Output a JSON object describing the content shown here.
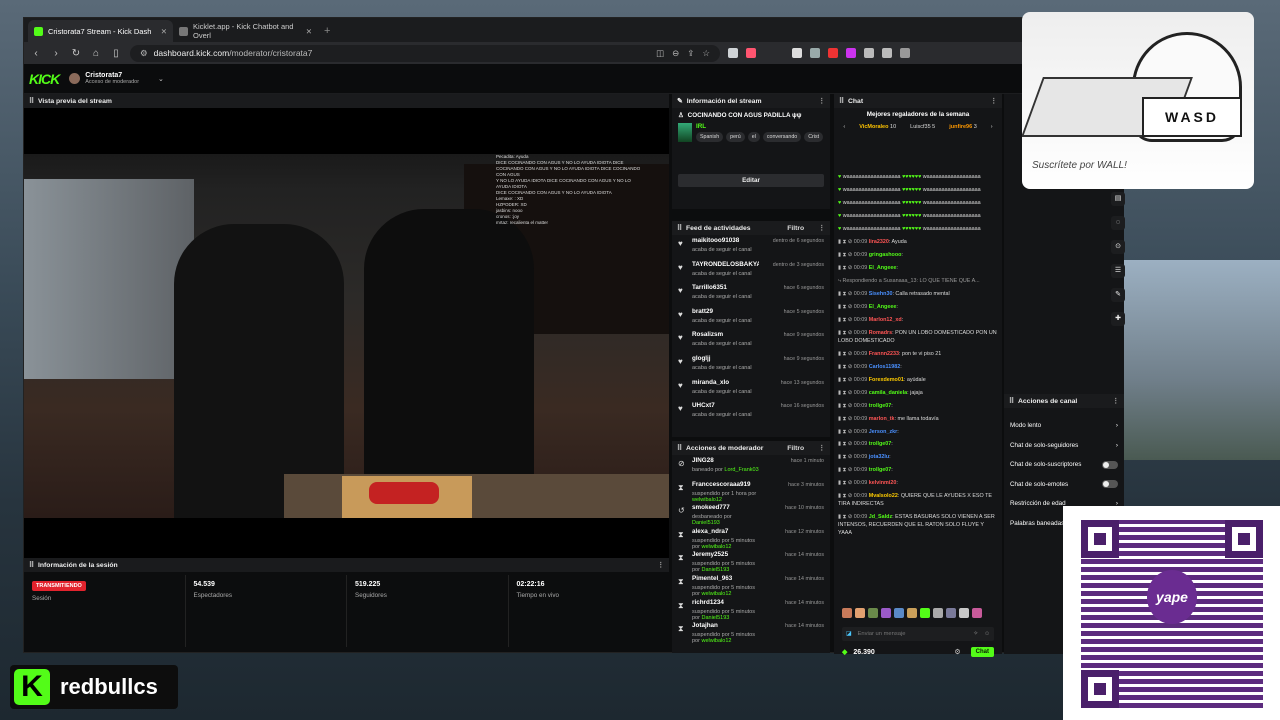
{
  "browser": {
    "tabs": [
      {
        "label": "Cristorata7 Stream - Kick Dash",
        "active": true,
        "favicon_color": "#53fc18"
      },
      {
        "label": "Kicklet.app - Kick Chatbot and Overl",
        "active": false,
        "favicon_color": "#777777"
      }
    ],
    "url_host": "dashboard.kick.com",
    "url_path": "/moderator/cristorata7"
  },
  "app": {
    "logo": "KICK",
    "channel_name": "Cristorata7",
    "channel_role": "Acceso de moderador"
  },
  "preview": {
    "title": "Vista previa del stream",
    "overlay_chat": [
      "Pecadita: Ayuda",
      "DICE COCINANDO CON AGUS Y NO LO AYUDA IDIOTA DICE",
      "COCINANDO CON AGUS Y NO LO AYUDA IDIOTA DICE COCINANDO CON AGUS",
      "Y NO LO AYUDA IDIOTA DICE COCINANDO CON AGUS Y NO LO AYUDA IDIOTA",
      "DICE COCINANDO CON AGUS Y NO LO AYUDA IDIOTA",
      "Lemaxe: : XD",
      "HZPODER: XD",
      "jasbins: nooo",
      "cronos: :joy",
      "mrtaz: recalienta el matter"
    ]
  },
  "session": {
    "title": "Información de la sesión",
    "stats": [
      {
        "value": "TRANSMITIENDO",
        "label": "Sesión",
        "badge": true
      },
      {
        "value": "54.539",
        "label": "Espectadores"
      },
      {
        "value": "519.225",
        "label": "Seguidores"
      },
      {
        "value": "02:22:16",
        "label": "Tiempo en vivo"
      }
    ]
  },
  "stream_info": {
    "title": "Información del stream",
    "stream_title": "COCINANDO CON AGUS PADILLA ψψ",
    "category": "IRL",
    "tags": [
      "Spanish",
      "perú",
      "el",
      "conversando",
      "Crist"
    ],
    "edit_label": "Editar"
  },
  "activity_feed": {
    "title": "Feed de actividades",
    "filter_label": "Filtro",
    "items": [
      {
        "user": "maikitooo91038",
        "action": "acaba de seguir el canal",
        "time": "dentro de 6 segundos"
      },
      {
        "user": "TAYRONDELOSBAKYAORIGAN",
        "action": "acaba de seguir el canal",
        "time": "dentro de 3 segundos"
      },
      {
        "user": "Tarrillo6351",
        "action": "acaba de seguir el canal",
        "time": "hace 6 segundos"
      },
      {
        "user": "bratt29",
        "action": "acaba de seguir el canal",
        "time": "hace 5 segundos"
      },
      {
        "user": "Rosalizsm",
        "action": "acaba de seguir el canal",
        "time": "hace 9 segundos"
      },
      {
        "user": "glogljj",
        "action": "acaba de seguir el canal",
        "time": "hace 9 segundos"
      },
      {
        "user": "miranda_xlo",
        "action": "acaba de seguir el canal",
        "time": "hace 13 segundos"
      },
      {
        "user": "UHCxt7",
        "action": "acaba de seguir el canal",
        "time": "hace 16 segundos"
      }
    ]
  },
  "mod_actions": {
    "title": "Acciones de moderador",
    "filter_label": "Filtro",
    "items": [
      {
        "user": "JING28",
        "action": "baneado por",
        "by": "Lord_Frank03",
        "time": "hace 1 minuto",
        "icon": "⊘"
      },
      {
        "user": "Franccescoraaa919",
        "action": "suspendido por 1 hora por",
        "by": "welwibalo12",
        "time": "hace 3 minutos",
        "icon": "⧗"
      },
      {
        "user": "smokeed777",
        "action": "desbaneado por",
        "by": "Daniel5193",
        "time": "hace 10 minutos",
        "icon": "↺"
      },
      {
        "user": "alexa_ndra7",
        "action": "suspendido por 5 minutos por",
        "by": "welwibalo12",
        "time": "hace 12 minutos",
        "icon": "⧗"
      },
      {
        "user": "Jeremy2525",
        "action": "suspendido por 5 minutos por",
        "by": "Daniel5193",
        "time": "hace 14 minutos",
        "icon": "⧗"
      },
      {
        "user": "Pimentel_963",
        "action": "suspendido por 5 minutos por",
        "by": "welwibalo12",
        "time": "hace 14 minutos",
        "icon": "⧗"
      },
      {
        "user": "richrd1234",
        "action": "suspendido por 5 minutos por",
        "by": "Daniel5193",
        "time": "hace 14 minutos",
        "icon": "⧗"
      },
      {
        "user": "Jotajhan",
        "action": "suspendido por 5 minutos por",
        "by": "welwibalo12",
        "time": "hace 14 minutos",
        "icon": "⧗"
      }
    ]
  },
  "chat": {
    "title": "Chat",
    "gifters_title": "Mejores regaladores de la semana",
    "gifters": [
      {
        "name": "VicMoraleo",
        "count": "10"
      },
      {
        "name": "Luiscf35",
        "count": "5"
      },
      {
        "name": "junfire96",
        "count": "3"
      }
    ],
    "spam_line": "waaaaaaaaaaaaaaaaaa",
    "reply_context": "Respondiendo a Susanaaa_13: LO QUE TIENE QUE A...",
    "messages": [
      {
        "time": "00:09",
        "user": "lira2320",
        "color": "#ff5555",
        "text": ": Ayuda"
      },
      {
        "time": "00:09",
        "user": "gringashooo",
        "color": "#53fc18",
        "text": ":"
      },
      {
        "time": "00:09",
        "user": "El_Angeee",
        "color": "#53fc18",
        "text": ":"
      },
      {
        "time": "00:09",
        "user": "Sisehn30",
        "color": "#4a90ff",
        "text": ": Calla retrasado mental"
      },
      {
        "time": "00:09",
        "user": "El_Angeee",
        "color": "#53fc18",
        "text": ":"
      },
      {
        "time": "00:09",
        "user": "Marlon12_xd",
        "color": "#ff5555",
        "text": ":"
      },
      {
        "time": "00:09",
        "user": "Romadrs",
        "color": "#ff5555",
        "text": ": PON UN LOBO DOMESTICADO  PON UN LOBO DOMESTICADO"
      },
      {
        "time": "00:09",
        "user": "Frannn2233",
        "color": "#ff5555",
        "text": ": pon te vi piso 21"
      },
      {
        "time": "00:09",
        "user": "Carlos11982",
        "color": "#4a90ff",
        "text": ":"
      },
      {
        "time": "00:09",
        "user": "Forexdemo01",
        "color": "#ffcc00",
        "text": ": ayúdale"
      },
      {
        "time": "00:09",
        "user": "camila_daniela",
        "color": "#53fc18",
        "text": ": jajaja"
      },
      {
        "time": "00:09",
        "user": "trollge07",
        "color": "#53fc18",
        "text": ":"
      },
      {
        "time": "00:09",
        "user": "marlon_tk",
        "color": "#ff5555",
        "text": ": me llama todavía"
      },
      {
        "time": "00:09",
        "user": "Jerson_zkr",
        "color": "#4a90ff",
        "text": ":"
      },
      {
        "time": "00:09",
        "user": "trollge07",
        "color": "#53fc18",
        "text": ":"
      },
      {
        "time": "00:09",
        "user": "jota32lu",
        "color": "#4a90ff",
        "text": ":"
      },
      {
        "time": "00:09",
        "user": "trollge07",
        "color": "#53fc18",
        "text": ":"
      },
      {
        "time": "00:09",
        "user": "kelvinmi20",
        "color": "#ff5555",
        "text": ":"
      },
      {
        "time": "00:09",
        "user": "Mvalsolo22",
        "color": "#ffcc00",
        "text": ": QUIERE QUE LE AYUDES X ESO TE TIRA INDIRECTAS"
      },
      {
        "time": "00:09",
        "user": "Jd_Saldz",
        "color": "#53fc18",
        "text": ": ESTAS BASURAS SOLO VIENEN A SER INTENSOS, RECUERDEN QUE EL RATON SOLO FLUYE Y YAAA"
      }
    ],
    "input_placeholder": "Enviar un mensaje",
    "points": "26.390",
    "send_label": "Chat"
  },
  "channel_actions": {
    "title": "Acciones de canal",
    "items": [
      {
        "label": "Modo lento",
        "control": "arrow"
      },
      {
        "label": "Chat de solo-seguidores",
        "control": "arrow"
      },
      {
        "label": "Chat de solo-suscriptores",
        "control": "toggle"
      },
      {
        "label": "Chat de solo-emotes",
        "control": "toggle"
      },
      {
        "label": "Restricción de edad",
        "control": "arrow"
      },
      {
        "label": "Palabras baneadas",
        "control": "arrow"
      }
    ]
  },
  "overlay": {
    "brand_name": "redbullcs",
    "qr_logo": "yape",
    "art_signature": "Suscrítete por WALL!",
    "art_keys": "WASD"
  },
  "colors": {
    "kick_green": "#53fc18",
    "live_red": "#e2232d",
    "panel_bg": "#141517",
    "yape_purple": "#6a2c91"
  }
}
